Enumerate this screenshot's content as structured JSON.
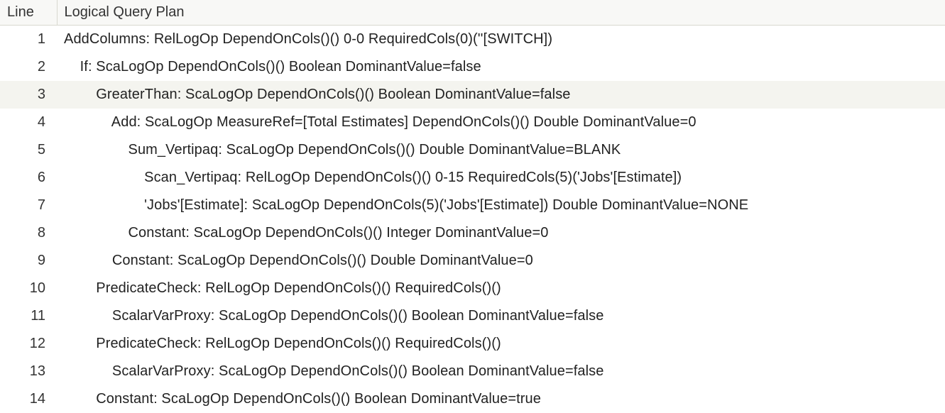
{
  "columns": {
    "line": "Line",
    "plan": "Logical Query Plan"
  },
  "highlight_line": 3,
  "rows": [
    {
      "n": 1,
      "indent": 0,
      "text": "AddColumns: RelLogOp DependOnCols()() 0-0 RequiredCols(0)(''[SWITCH])"
    },
    {
      "n": 2,
      "indent": 1,
      "text": "If: ScaLogOp DependOnCols()() Boolean DominantValue=false"
    },
    {
      "n": 3,
      "indent": 2,
      "text": "GreaterThan: ScaLogOp DependOnCols()() Boolean DominantValue=false"
    },
    {
      "n": 4,
      "indent": 3,
      "text": "Add: ScaLogOp MeasureRef=[Total Estimates] DependOnCols()() Double DominantValue=0"
    },
    {
      "n": 5,
      "indent": 4,
      "text": "Sum_Vertipaq: ScaLogOp DependOnCols()() Double DominantValue=BLANK"
    },
    {
      "n": 6,
      "indent": 5,
      "text": "Scan_Vertipaq: RelLogOp DependOnCols()() 0-15 RequiredCols(5)('Jobs'[Estimate])"
    },
    {
      "n": 7,
      "indent": 5,
      "text": "'Jobs'[Estimate]: ScaLogOp DependOnCols(5)('Jobs'[Estimate]) Double DominantValue=NONE"
    },
    {
      "n": 8,
      "indent": 4,
      "text": "Constant: ScaLogOp DependOnCols()() Integer DominantValue=0"
    },
    {
      "n": 9,
      "indent": 3,
      "text": "Constant: ScaLogOp DependOnCols()() Double DominantValue=0"
    },
    {
      "n": 10,
      "indent": 2,
      "text": "PredicateCheck: RelLogOp DependOnCols()() RequiredCols()()"
    },
    {
      "n": 11,
      "indent": 3,
      "text": "ScalarVarProxy: ScaLogOp DependOnCols()() Boolean DominantValue=false"
    },
    {
      "n": 12,
      "indent": 2,
      "text": "PredicateCheck: RelLogOp DependOnCols()() RequiredCols()()"
    },
    {
      "n": 13,
      "indent": 3,
      "text": "ScalarVarProxy: ScaLogOp DependOnCols()() Boolean DominantValue=false"
    },
    {
      "n": 14,
      "indent": 2,
      "text": "Constant: ScaLogOp DependOnCols()() Boolean DominantValue=true"
    }
  ]
}
